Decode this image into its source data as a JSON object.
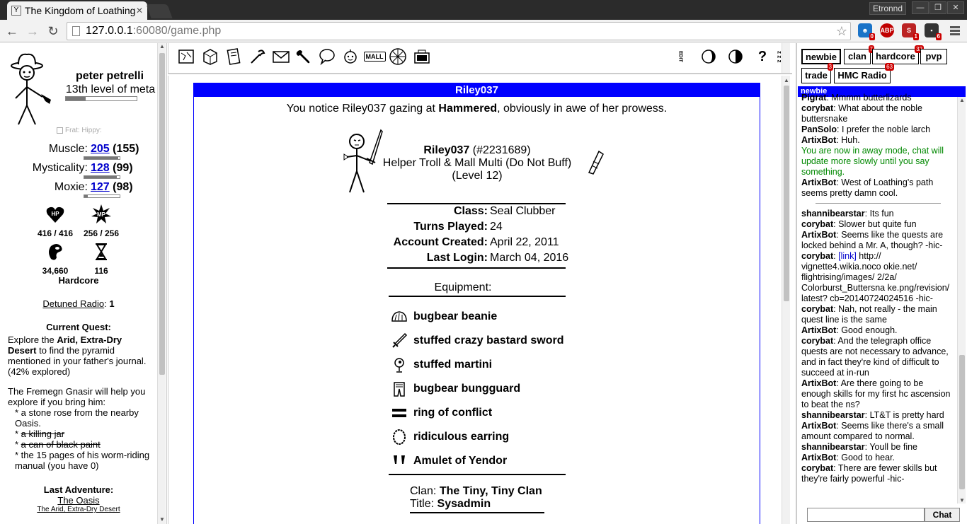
{
  "browser": {
    "tab_title": "The Kingdom of Loathing",
    "user_name": "Etronnd",
    "url_host": "127.0.0.1",
    "url_rest": ":60080/game.php",
    "extensions": [
      {
        "name": "ghost-ext",
        "badge": "0",
        "color": "#1a73c8"
      },
      {
        "name": "adblock-plus",
        "badge": "",
        "color": "#c00000"
      },
      {
        "name": "s-ext",
        "badge": "1",
        "color": "#b22"
      },
      {
        "name": "dark-ext",
        "badge": "6",
        "color": "#333"
      }
    ]
  },
  "charpane": {
    "name": "peter petrelli",
    "level": "13th level of meta",
    "level_progress": 0.28,
    "frat_hippy": "Frat: Hippy:",
    "stats": [
      {
        "label": "Muscle:",
        "value": "205",
        "base": "(155)",
        "progress": 0.95
      },
      {
        "label": "Mysticality:",
        "value": "128",
        "base": "(99)",
        "progress": 0.92
      },
      {
        "label": "Moxie:",
        "value": "127",
        "base": "(98)",
        "progress": 0.1
      }
    ],
    "hp": "416 / 416",
    "hp_icon_text": "HP",
    "mp": "256 / 256",
    "mp_icon_text": "MP",
    "meat": "34,660",
    "adventures": "116",
    "path": "Hardcore",
    "radio_label": "Detuned Radio",
    "radio_sep": ":",
    "radio_value": "1",
    "quest_heading": "Current Quest:",
    "quest_p1_a": "Explore the ",
    "quest_p1_b": "Arid, Extra-Dry Desert",
    "quest_p1_c": " to find the pyramid mentioned in your father's journal. (42% explored)",
    "quest_p2": "The Fremegn Gnasir will help you explore if you bring him:",
    "quest_items": [
      {
        "text": "* a stone rose from the nearby Oasis.",
        "struck": false
      },
      {
        "text": "a killing jar",
        "struck": true
      },
      {
        "text": "a can of black paint",
        "struck": true
      },
      {
        "text": "* the 15 pages of his worm-riding manual (you have 0)",
        "struck": false
      }
    ],
    "bullet": "* ",
    "last_adv_heading": "Last Adventure:",
    "last_adv_place": "The Oasis",
    "last_adv_zone": "The Arid, Extra-Dry Desert"
  },
  "toppane": {
    "icons": [
      "map-icon",
      "inventory-icon",
      "quests-icon",
      "skills-icon",
      "mail-icon",
      "options-icon",
      "chat-bubble-icon",
      "familiar-icon",
      "mall-icon",
      "oracle-icon",
      "clan-icon"
    ],
    "mall_label": "MALL",
    "right_icons": [
      "edit-icon",
      "moon-icon",
      "half-moon-icon",
      "help-icon",
      "sleep-icon"
    ],
    "right_text": {
      "edit": "EDIT",
      "help": "?",
      "zz": "z z z"
    }
  },
  "profile": {
    "header": "Riley037",
    "notice_a": "You notice Riley037 gazing at ",
    "notice_b": "Hammered",
    "notice_c": ", obviously in awe of her prowess.",
    "name": "Riley037",
    "id": "(#2231689)",
    "title": "Helper Troll & Mall Multi (Do Not Buff)",
    "level": "(Level 12)",
    "fields": [
      {
        "k": "Class:",
        "v": "Seal Clubber"
      },
      {
        "k": "Turns Played:",
        "v": "24"
      },
      {
        "k": "Account Created:",
        "v": "April 22, 2011"
      },
      {
        "k": "Last Login:",
        "v": "March 04, 2016"
      }
    ],
    "equipment_heading": "Equipment:",
    "equipment": [
      {
        "name": "bugbear beanie",
        "icon": "beanie-icon"
      },
      {
        "name": "stuffed crazy bastard sword",
        "icon": "sword-icon"
      },
      {
        "name": "stuffed martini",
        "icon": "martini-icon"
      },
      {
        "name": "bugbear bungguard",
        "icon": "bungguard-icon"
      },
      {
        "name": "ring of conflict",
        "icon": "ring-icon"
      },
      {
        "name": "ridiculous earring",
        "icon": "earring-icon"
      },
      {
        "name": "Amulet of Yendor",
        "icon": "amulet-icon"
      }
    ],
    "clan_label": "Clan:",
    "clan_name": "The Tiny, Tiny Clan",
    "title_label": "Title:",
    "title_value": "Sysadmin"
  },
  "chat": {
    "tabs": [
      {
        "label": "newbie",
        "badge": "",
        "selected": true
      },
      {
        "label": "clan",
        "badge": "7",
        "selected": false
      },
      {
        "label": "hardcore",
        "badge": "32",
        "selected": false
      },
      {
        "label": "pvp",
        "badge": "",
        "selected": false
      },
      {
        "label": "trade",
        "badge": "3",
        "selected": false
      },
      {
        "label": "HMC Radio",
        "badge": "63",
        "selected": false
      }
    ],
    "channel_header": "newbie",
    "messages_a": [
      {
        "user": "Pigrat",
        "text": ": Mmmm butterlizards"
      },
      {
        "user": "corybat",
        "text": ": What about the noble buttersnake"
      },
      {
        "user": "PanSolo",
        "text": ": I prefer the noble larch"
      },
      {
        "user": "ArtixBot",
        "text": ": Huh."
      }
    ],
    "system_msg": "You are now in away mode, chat will update more slowly until you say something.",
    "messages_b": [
      {
        "user": "ArtixBot",
        "text": ": West of Loathing's path seems pretty damn cool."
      }
    ],
    "messages_c": [
      {
        "user": "shannibearstar",
        "text": ": Its fun"
      },
      {
        "user": "corybat",
        "text": ": Slower but quite fun"
      },
      {
        "user": "ArtixBot",
        "text": ": Seems like the quests are locked behind a Mr. A, though? -hic-"
      }
    ],
    "link_user": "corybat",
    "link_label": "[link]",
    "link_text": " http:// vignette4.wikia.noco okie.net/ flightrising/images/ 2/2a/ Colorburst_Buttersna ke.png/revision/ latest? cb=20140724024516 -hic-",
    "messages_d": [
      {
        "user": "corybat",
        "text": ": Nah, not really - the main quest line is the same"
      },
      {
        "user": "ArtixBot",
        "text": ": Good enough."
      },
      {
        "user": "corybat",
        "text": ": And the telegraph office quests are not necessary to advance, and in fact they're kind of difficult to succeed at in-run"
      },
      {
        "user": "ArtixBot",
        "text": ": Are there going to be enough skills for my first hc ascension to beat the ns?"
      },
      {
        "user": "shannibearstar",
        "text": ": LT&T is pretty hard"
      },
      {
        "user": "ArtixBot",
        "text": ": Seems like there's a small amount compared to normal."
      },
      {
        "user": "shannibearstar",
        "text": ": Youll be fine"
      },
      {
        "user": "ArtixBot",
        "text": ": Good to hear."
      },
      {
        "user": "corybat",
        "text": ": There are fewer skills but they're fairly powerful -hic-"
      }
    ],
    "input_value": "",
    "send_label": "Chat"
  }
}
